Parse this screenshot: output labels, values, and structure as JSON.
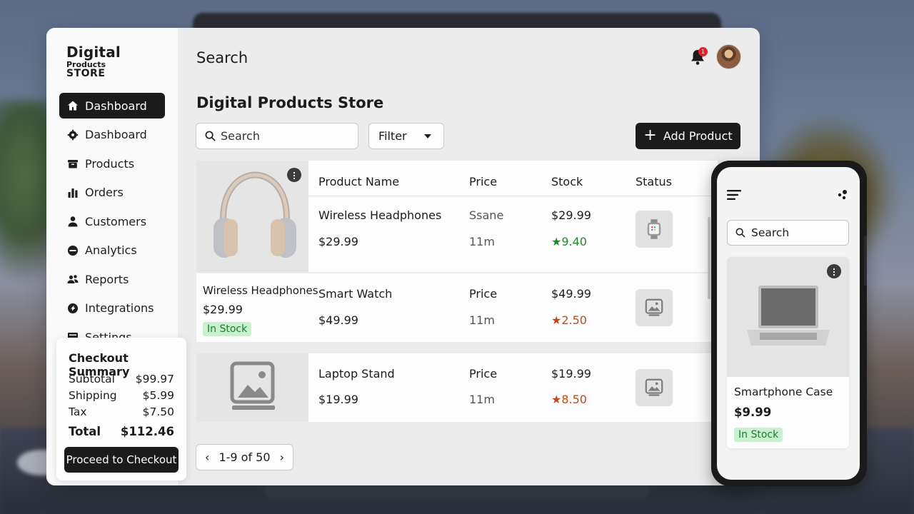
{
  "brand": {
    "line1": "Digital",
    "line2": "Products",
    "line3": "STORE"
  },
  "topbar": {
    "title": "Search",
    "notification_count": "1"
  },
  "sidebar": {
    "items": [
      {
        "label": "Dashboard",
        "icon": "home-icon",
        "active": true
      },
      {
        "label": "Dashboard",
        "icon": "dashboard-gear-icon"
      },
      {
        "label": "Products",
        "icon": "box-icon"
      },
      {
        "label": "Orders",
        "icon": "bar-chart-icon"
      },
      {
        "label": "Customers",
        "icon": "user-icon"
      },
      {
        "label": "Analytics",
        "icon": "analytics-icon"
      },
      {
        "label": "Reports",
        "icon": "users-icon"
      },
      {
        "label": "Integrations",
        "icon": "integrations-icon"
      },
      {
        "label": "Settings",
        "icon": "settings-icon"
      }
    ]
  },
  "checkout": {
    "title": "Checkout Summary",
    "subtotal_label": "Subtotal",
    "subtotal": "$99.97",
    "shipping_label": "Shipping",
    "shipping": "$5.99",
    "tax_label": "Tax",
    "tax": "$7.50",
    "total_label": "Total",
    "total": "$112.46",
    "button": "Proceed to Checkout"
  },
  "main": {
    "page_title": "Digital Products Store",
    "search_placeholder": "Search",
    "filter_label": "Filter",
    "add_button": "Add Product",
    "columns": [
      "Product Name",
      "Price",
      "Stock",
      "Status"
    ],
    "rows": [
      {
        "name": "Wireless Headphones",
        "price": "$29.99",
        "col2a": "Ssane",
        "col2b": "11m",
        "stock": "$29.99",
        "rating": "★9.40",
        "status_icon": "smartwatch-icon"
      },
      {
        "name": "Smart Watch",
        "price": "$49.99",
        "col2a": "Price",
        "col2b": "11m",
        "stock": "$49.99",
        "rating": "★2.50",
        "status_icon": "image-placeholder-icon"
      },
      {
        "name": "Laptop Stand",
        "price": "$19.99",
        "col2a": "Price",
        "col2b": "11m",
        "stock": "$19.99",
        "rating": "★8.50",
        "status_icon": "image-placeholder-icon"
      }
    ],
    "feature_card": {
      "name": "Wireless Headphones",
      "price": "$29.99",
      "badge": "In Stock"
    },
    "pager": "1-9 of 50"
  },
  "phone": {
    "search_placeholder": "Search",
    "product": {
      "name": "Smartphone Case",
      "price": "$9.99",
      "badge": "In Stock"
    }
  },
  "colors": {
    "accent": "#1b1b1b",
    "badge_bg": "#c9f1cf",
    "badge_text": "#1b7a2b",
    "rating_green": "#1f8a2a",
    "rating_orange": "#c0491a",
    "notification": "#e0202a"
  }
}
